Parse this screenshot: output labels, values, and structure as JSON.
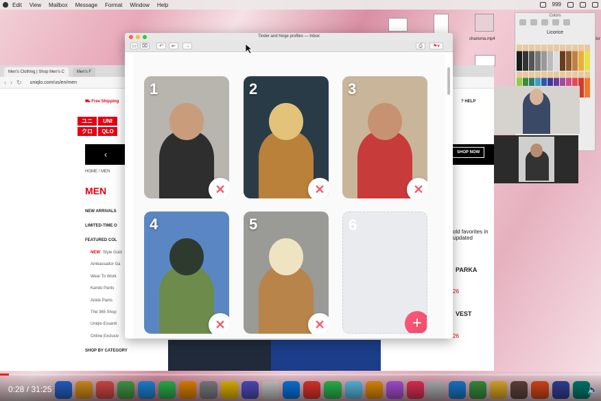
{
  "menubar": {
    "items": [
      "Edit",
      "View",
      "Mailbox",
      "Message",
      "Format",
      "Window",
      "Help"
    ],
    "battery": "999"
  },
  "browser": {
    "tabs": [
      "Men's Clothing | Shop Men's C",
      "Men's F"
    ],
    "url": "uniqlo.com/us/en/men",
    "free_shipping": "Free Shipping",
    "logo_cells": [
      "ユニ",
      "UNI",
      "クロ",
      "QLO"
    ],
    "breadcrumb": "HOME / MEN",
    "section_title": "MEN",
    "nav": [
      "NEW ARRIVALS",
      "LIMITED-TIME O",
      "FEATURED COL"
    ],
    "sub_items": [
      {
        "badge": "NEW",
        "label": "Style Guid"
      },
      {
        "badge": "",
        "label": "Ambassador Ga"
      },
      {
        "badge": "",
        "label": "Wear To Work"
      },
      {
        "badge": "",
        "label": "Kando Pants"
      },
      {
        "badge": "",
        "label": "Ankle Pants"
      },
      {
        "badge": "",
        "label": "The 365 Shop"
      },
      {
        "badge": "",
        "label": "Uniqlo Essenti"
      },
      {
        "badge": "",
        "label": "Online Exclusiv"
      }
    ],
    "shop_by_category": "SHOP BY CATEGORY",
    "help": "HELP",
    "shop_now": "SHOP NOW",
    "right_text": "old favorites in updated",
    "parka": "PARKA",
    "vest": "VEST",
    "price1": "26",
    "price2": "26"
  },
  "colors_window": {
    "title": "Colors",
    "selected": "Licorice",
    "pencil_colors": [
      "#1a1a1a",
      "#333",
      "#555",
      "#777",
      "#999",
      "#bbb",
      "#ddd",
      "#6b3b1e",
      "#8a5a2b",
      "#c08040",
      "#e6b03a",
      "#e8e04a",
      "#98c94a",
      "#3c8c3c",
      "#2f7a6a",
      "#3aa0c0",
      "#2a5aa8",
      "#3a3a9a",
      "#6a3a9a",
      "#a04aa0",
      "#d04a8a",
      "#e24a5a",
      "#d43a2a",
      "#f07a2a",
      "#f6b0c8",
      "#e090b0",
      "#c06a9a",
      "#f0d0e0"
    ]
  },
  "desktop": {
    "file1": "charisma.mp4",
    "file2": "Scr"
  },
  "mail": {
    "title": "Tinder and hinge profiles — Inbox",
    "slots": [
      {
        "num": "1",
        "bg": "#b8b4ae",
        "fill": "#2e2e2e",
        "face": "#c99c7c"
      },
      {
        "num": "2",
        "bg": "#2a3b48",
        "fill": "#b9813a",
        "face": "#e3c37a"
      },
      {
        "num": "3",
        "bg": "#c9b59a",
        "fill": "#c73b3b",
        "face": "#c79271"
      },
      {
        "num": "4",
        "bg": "#5a87c4",
        "fill": "#6d8b4a",
        "face": "#2f3a2f"
      },
      {
        "num": "5",
        "bg": "#9a9a96",
        "fill": "#b8844a",
        "face": "#efe4c2"
      }
    ],
    "empty_slot": "6",
    "remove_symbol": "✕",
    "add_symbol": "+"
  },
  "video": {
    "elapsed": "0:28",
    "total": "31:25",
    "separator": " / ",
    "progress": 0.015
  },
  "dock_colors": [
    "#2a6de0",
    "#f0a020",
    "#ef5350",
    "#4caf50",
    "#2196f3",
    "#34c759",
    "#ff9500",
    "#8e8e93",
    "#ffcc00",
    "#5856d6",
    "#e0e0e0",
    "#0a84ff",
    "#ff3b30",
    "#30d158",
    "#64d2ff",
    "#ff9f0a",
    "#bf5af2",
    "#ff375f",
    "#c7c7cc",
    "#1e88e5",
    "#43a047",
    "#fbc02d",
    "#6d4c41",
    "#f4511e",
    "#3949ab",
    "#00897b"
  ]
}
